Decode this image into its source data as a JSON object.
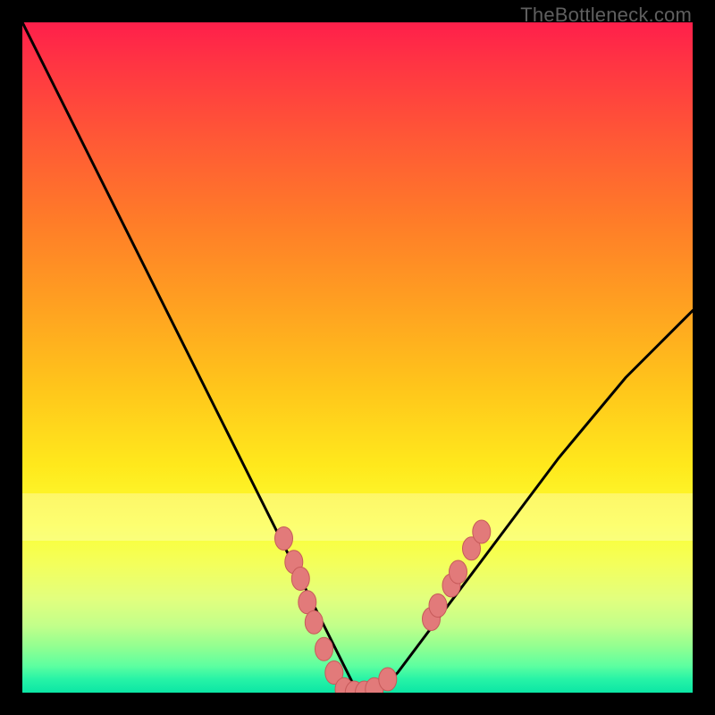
{
  "watermark": "TheBottleneck.com",
  "colors": {
    "curve_stroke": "#000000",
    "marker_fill": "#e27a7a",
    "marker_stroke": "#c75a5a"
  },
  "chart_data": {
    "type": "line",
    "title": "",
    "xlabel": "",
    "ylabel": "",
    "xlim": [
      0,
      100
    ],
    "ylim": [
      0,
      100
    ],
    "series": [
      {
        "name": "curve",
        "x": [
          0,
          3,
          6,
          9,
          12,
          15,
          18,
          21,
          24,
          27,
          30,
          33,
          36,
          39,
          42,
          45,
          48,
          50,
          53,
          56,
          59,
          62,
          65,
          68,
          71,
          74,
          77,
          80,
          85,
          90,
          95,
          100
        ],
        "y": [
          100,
          94,
          88,
          82,
          76,
          70,
          64,
          58,
          52,
          46,
          40,
          34,
          28,
          22,
          16,
          10,
          4,
          0,
          0,
          3,
          7,
          11,
          15,
          19,
          23,
          27,
          31,
          35,
          41,
          47,
          52,
          57
        ]
      }
    ],
    "markers": [
      {
        "x": 39.0,
        "y": 23.0
      },
      {
        "x": 40.5,
        "y": 19.5
      },
      {
        "x": 41.5,
        "y": 17.0
      },
      {
        "x": 42.5,
        "y": 13.5
      },
      {
        "x": 43.5,
        "y": 10.5
      },
      {
        "x": 45.0,
        "y": 6.5
      },
      {
        "x": 46.5,
        "y": 3.0
      },
      {
        "x": 48.0,
        "y": 0.5
      },
      {
        "x": 49.5,
        "y": 0.0
      },
      {
        "x": 51.0,
        "y": 0.0
      },
      {
        "x": 52.5,
        "y": 0.5
      },
      {
        "x": 54.5,
        "y": 2.0
      },
      {
        "x": 61.0,
        "y": 11.0
      },
      {
        "x": 62.0,
        "y": 13.0
      },
      {
        "x": 64.0,
        "y": 16.0
      },
      {
        "x": 65.0,
        "y": 18.0
      },
      {
        "x": 67.0,
        "y": 21.5
      },
      {
        "x": 68.5,
        "y": 24.0
      }
    ]
  }
}
